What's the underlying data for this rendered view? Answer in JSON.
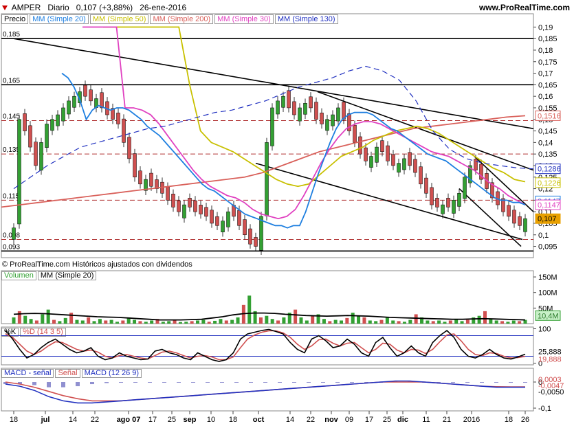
{
  "header": {
    "symbol": "AMPER",
    "period": "Diario",
    "price_change": "0,107 (+3,88%)",
    "date": "26-ene-2016",
    "site": "www.ProRealTime.com"
  },
  "legend": {
    "price": "Precio",
    "ma20": "MM (Simple 20)",
    "ma50": "MM (Simple 50)",
    "ma200": "MM (Simple 200)",
    "ma30": "MM (Simple 30)",
    "ma130": "MM (Simple 130)"
  },
  "footer_note": "© ProRealTime.com Históricos ajustados con dividendos",
  "colors": {
    "ma20": "#1e7fe0",
    "ma50": "#c8c000",
    "ma200": "#d9605a",
    "ma30": "#e040c0",
    "ma130": "#2030c0",
    "up": "#33a033",
    "down": "#d05050",
    "hline": "#b03030"
  },
  "chart_data": [
    {
      "type": "line",
      "name": "price_panel",
      "y_ticks": [
        "0,19",
        "0,185",
        "0,18",
        "0,175",
        "0,17",
        "0,165",
        "0,16",
        "0,155",
        "0,15",
        "0,145",
        "0,14",
        "0,135",
        "0,13",
        "0,125",
        "0,12",
        "0,115",
        "0,11",
        "0,105",
        "0,1",
        "0,095"
      ],
      "ylim": [
        0.091,
        0.191
      ],
      "level_labels": [
        "0,185",
        "0,165",
        "0,145",
        "0,135",
        "0,115",
        "0,098",
        "0,093"
      ],
      "levels": [
        0.185,
        0.165,
        0.1495,
        0.135,
        0.115,
        0.098,
        0.093
      ],
      "price_tags": [
        {
          "label": "0,1516",
          "value": 0.1516,
          "color": "#d9605a"
        },
        {
          "label": "0,1286",
          "value": 0.1286,
          "color": "#2030c0"
        },
        {
          "label": "0,1226",
          "value": 0.1226,
          "color": "#c8c000"
        },
        {
          "label": "0,1147",
          "value": 0.1147,
          "color": "#1e7fe0"
        },
        {
          "label": "0,1147",
          "value": 0.113,
          "color": "#e040c0"
        },
        {
          "label": "0,107",
          "value": 0.107,
          "color": "#e8a000"
        }
      ],
      "x_labels": [
        "18",
        "jul",
        "14",
        "22",
        "ago 07",
        "17",
        "25",
        "sep",
        "10",
        "18",
        "oct",
        "14",
        "22",
        "nov",
        "09",
        "17",
        "25",
        "dic",
        "11",
        "21",
        "2016",
        "18",
        "26"
      ],
      "close": [
        0.103,
        0.15,
        0.145,
        0.138,
        0.13,
        0.14,
        0.148,
        0.15,
        0.152,
        0.155,
        0.158,
        0.16,
        0.162,
        0.16,
        0.158,
        0.159,
        0.155,
        0.152,
        0.15,
        0.148,
        0.14,
        0.133,
        0.125,
        0.122,
        0.124,
        0.121,
        0.12,
        0.118,
        0.115,
        0.112,
        0.11,
        0.113,
        0.112,
        0.11,
        0.109,
        0.108,
        0.105,
        0.104,
        0.106,
        0.11,
        0.108,
        0.104,
        0.1,
        0.096,
        0.095,
        0.108,
        0.14,
        0.155,
        0.158,
        0.16,
        0.155,
        0.152,
        0.155,
        0.157,
        0.155,
        0.15,
        0.148,
        0.15,
        0.152,
        0.155,
        0.15,
        0.145,
        0.14,
        0.135,
        0.132,
        0.134,
        0.138,
        0.136,
        0.132,
        0.13,
        0.131,
        0.133,
        0.13,
        0.127,
        0.122,
        0.118,
        0.113,
        0.112,
        0.113,
        0.112,
        0.115,
        0.118,
        0.125,
        0.13,
        0.128,
        0.124,
        0.12,
        0.116,
        0.113,
        0.11,
        0.108,
        0.105,
        0.104,
        0.107
      ],
      "ma20": [
        0.17,
        0.168,
        0.164,
        0.158,
        0.15,
        0.154,
        0.156,
        0.155,
        0.154,
        0.155,
        0.155,
        0.154,
        0.152,
        0.15,
        0.147,
        0.145,
        0.143,
        0.14,
        0.137,
        0.134,
        0.131,
        0.128,
        0.125,
        0.122,
        0.12,
        0.119,
        0.117,
        0.115,
        0.113,
        0.111,
        0.109,
        0.108,
        0.107,
        0.106,
        0.105,
        0.104,
        0.104,
        0.103,
        0.104,
        0.104,
        0.11,
        0.118,
        0.126,
        0.133,
        0.14,
        0.146,
        0.15,
        0.152,
        0.153,
        0.153,
        0.153,
        0.152,
        0.15,
        0.148,
        0.146,
        0.145,
        0.143,
        0.141,
        0.139,
        0.137,
        0.135,
        0.134,
        0.133,
        0.132,
        0.13,
        0.128,
        0.126,
        0.124,
        0.122,
        0.12,
        0.118,
        0.116,
        0.115,
        0.115,
        0.114,
        0.114,
        0.113
      ],
      "ma50": [
        0.19,
        0.19,
        0.19,
        0.19,
        0.19,
        0.19,
        0.19,
        0.19,
        0.165,
        0.145,
        0.14,
        0.138,
        0.136,
        0.133,
        0.13,
        0.127,
        0.124,
        0.122,
        0.121,
        0.122,
        0.126,
        0.13,
        0.134,
        0.136,
        0.138,
        0.141,
        0.143,
        0.145,
        0.146,
        0.147,
        0.146,
        0.144,
        0.141,
        0.138,
        0.135,
        0.132,
        0.129,
        0.127,
        0.124,
        0.123
      ],
      "ma200": [
        0.112,
        0.113,
        0.114,
        0.115,
        0.116,
        0.117,
        0.118,
        0.119,
        0.12,
        0.121,
        0.122,
        0.123,
        0.124,
        0.125,
        0.127,
        0.13,
        0.133,
        0.136,
        0.138,
        0.14,
        0.142,
        0.144,
        0.146,
        0.147,
        0.148,
        0.149,
        0.15,
        0.151,
        0.1516
      ],
      "ma30": [
        0.19,
        0.19,
        0.19,
        0.19,
        0.19,
        0.155,
        0.155,
        0.154,
        0.152,
        0.148,
        0.143,
        0.138,
        0.133,
        0.128,
        0.124,
        0.121,
        0.119,
        0.117,
        0.116,
        0.114,
        0.111,
        0.109,
        0.108,
        0.107,
        0.108,
        0.111,
        0.117,
        0.124,
        0.131,
        0.137,
        0.142,
        0.146,
        0.148,
        0.149,
        0.149,
        0.148,
        0.146,
        0.144,
        0.142,
        0.14,
        0.138,
        0.136,
        0.135,
        0.134,
        0.132,
        0.13,
        0.128,
        0.125,
        0.122,
        0.12,
        0.117,
        0.115,
        0.113
      ],
      "ma130": [
        0.12,
        0.125,
        0.13,
        0.134,
        0.138,
        0.14,
        0.142,
        0.144,
        0.146,
        0.147,
        0.149,
        0.151,
        0.153,
        0.154,
        0.156,
        0.158,
        0.161,
        0.164,
        0.166,
        0.168,
        0.171,
        0.173,
        0.171,
        0.167,
        0.158,
        0.145,
        0.137,
        0.133,
        0.131,
        0.13,
        0.129,
        0.1286
      ]
    },
    {
      "type": "bar",
      "name": "volume_panel",
      "legend": [
        "Volumen",
        "MM (Simple 20)"
      ],
      "y_ticks": [
        "150M",
        "100M",
        "50M"
      ],
      "ylim": [
        0,
        170
      ],
      "last_label": "10,4M",
      "values": [
        20,
        40,
        25,
        15,
        10,
        30,
        45,
        12,
        8,
        18,
        35,
        12,
        10,
        20,
        8,
        15,
        10,
        12,
        6,
        10,
        20,
        12,
        8,
        6,
        10,
        15,
        6,
        8,
        12,
        5,
        6,
        8,
        10,
        12,
        6,
        9,
        15,
        10,
        12,
        20,
        60,
        90,
        40,
        20,
        25,
        15,
        10,
        20,
        35,
        45,
        20,
        10,
        25,
        30,
        15,
        8,
        12,
        10,
        18,
        35,
        25,
        20,
        10,
        8,
        12,
        20,
        10,
        8,
        6,
        12,
        30,
        20,
        10,
        8,
        10,
        6,
        10,
        15,
        8,
        12,
        20,
        25,
        40,
        15,
        10,
        8,
        6,
        10,
        8,
        12
      ],
      "ma": [
        30,
        32,
        33,
        32,
        30,
        28,
        26,
        24,
        22,
        21,
        20,
        18,
        16,
        14,
        12,
        12,
        12,
        13,
        14,
        18,
        22,
        28,
        32,
        34,
        34,
        33,
        30,
        28,
        26,
        25,
        24,
        25,
        26,
        25,
        24,
        22,
        20,
        19,
        18,
        17,
        16,
        15,
        14,
        14,
        15,
        16,
        15,
        14,
        13,
        12
      ]
    },
    {
      "type": "line",
      "name": "stochastic_panel",
      "legend": [
        "%K",
        "%D (14 3 5)"
      ],
      "y_ticks": [
        "100",
        "0"
      ],
      "ylim": [
        -5,
        105
      ],
      "tags": [
        {
          "label": "25,888",
          "value": 25.888
        },
        {
          "label": "19,888",
          "value": 19.888
        }
      ],
      "k": [
        95,
        70,
        40,
        15,
        25,
        45,
        60,
        70,
        55,
        40,
        30,
        35,
        45,
        20,
        10,
        15,
        30,
        20,
        15,
        10,
        12,
        35,
        40,
        30,
        25,
        15,
        10,
        30,
        20,
        10,
        5,
        10,
        30,
        70,
        85,
        90,
        95,
        98,
        92,
        85,
        60,
        40,
        30,
        70,
        80,
        65,
        45,
        50,
        70,
        55,
        30,
        20,
        60,
        75,
        45,
        20,
        30,
        50,
        30,
        20,
        60,
        80,
        95,
        75,
        40,
        20,
        15,
        25,
        40,
        25,
        15,
        12,
        18,
        26
      ],
      "d": [
        85,
        75,
        55,
        35,
        25,
        35,
        50,
        62,
        60,
        50,
        40,
        35,
        38,
        32,
        20,
        15,
        22,
        25,
        20,
        15,
        12,
        22,
        32,
        35,
        30,
        22,
        15,
        20,
        22,
        18,
        10,
        10,
        18,
        45,
        70,
        82,
        90,
        94,
        94,
        88,
        75,
        55,
        40,
        50,
        68,
        70,
        58,
        50,
        58,
        60,
        45,
        30,
        40,
        58,
        55,
        38,
        30,
        40,
        38,
        28,
        40,
        62,
        82,
        85,
        65,
        40,
        25,
        22,
        30,
        28,
        20,
        15,
        16,
        19.888
      ]
    },
    {
      "type": "line",
      "name": "macd_panel",
      "legend": [
        "MACD - señal",
        "Señal",
        "MACD (12 26 9)"
      ],
      "y_ticks": [
        "0",
        "-0,1"
      ],
      "ylim": [
        -0.1,
        0.004
      ],
      "tags": [
        {
          "label": "0,0003",
          "value": 0.0003
        },
        {
          "label": "-0,0047",
          "value": -0.0047
        },
        {
          "label": "-0,0050",
          "value": -0.005
        }
      ],
      "macd": [
        -0.002,
        -0.004,
        -0.008,
        -0.014,
        -0.018,
        -0.02,
        -0.02,
        -0.019,
        -0.018,
        -0.017,
        -0.016,
        -0.015,
        -0.014,
        -0.013,
        -0.012,
        -0.011,
        -0.01,
        -0.009,
        -0.008,
        -0.007,
        -0.006,
        -0.005,
        -0.004,
        -0.003,
        -0.002,
        -0.001,
        0.0,
        0.001,
        0.001,
        0.0,
        -0.001,
        -0.002,
        -0.003,
        -0.004,
        -0.005,
        -0.005,
        -0.005
      ],
      "signal": [
        0.0,
        -0.002,
        -0.005,
        -0.009,
        -0.013,
        -0.016,
        -0.018,
        -0.018,
        -0.018,
        -0.017,
        -0.016,
        -0.015,
        -0.014,
        -0.013,
        -0.012,
        -0.011,
        -0.01,
        -0.009,
        -0.008,
        -0.007,
        -0.006,
        -0.005,
        -0.004,
        -0.003,
        -0.002,
        -0.001,
        0.0,
        0.0,
        0.0,
        0.0,
        -0.001,
        -0.002,
        -0.003,
        -0.004,
        -0.0045,
        -0.0047,
        -0.0047
      ]
    }
  ]
}
